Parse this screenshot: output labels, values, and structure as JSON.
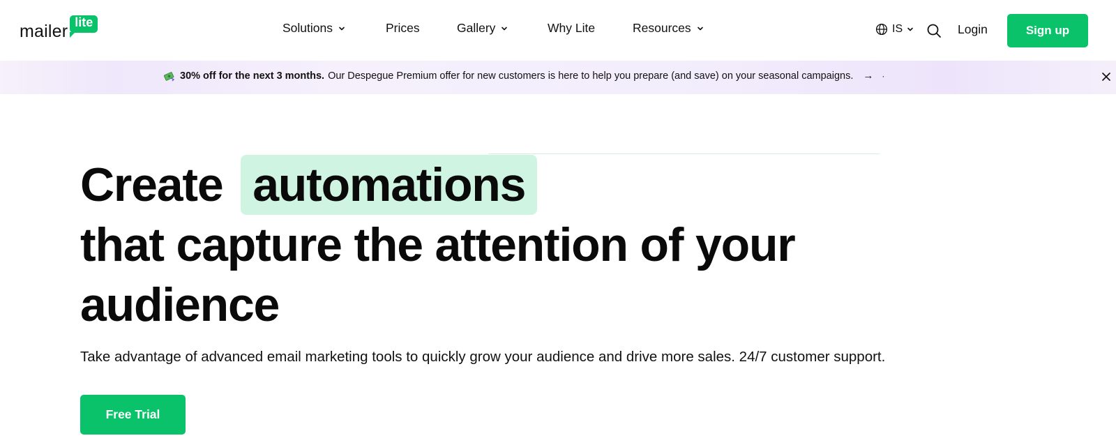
{
  "header": {
    "logo_text": "mailer",
    "logo_badge": "lite",
    "nav": {
      "solutions": "Solutions",
      "prices": "Prices",
      "gallery": "Gallery",
      "why_lite": "Why Lite",
      "resources": "Resources"
    },
    "language": "IS",
    "login": "Login",
    "signup": "Sign up"
  },
  "promo": {
    "emoji_icon": "money-icon",
    "strong_text": "30% off for the next 3 months.",
    "text": "Our Despegue Premium offer for new customers is here to help you prepare (and save) on your seasonal campaigns.",
    "arrow": "→",
    "dot": "·"
  },
  "hero": {
    "title_prefix": "Create",
    "title_highlight": "automations",
    "title_line2": "that capture the attention of your",
    "title_line3": "audience",
    "subtitle": "Take advantage of advanced email marketing tools to quickly grow your audience and drive more sales. 24/7 customer support.",
    "cta": "Free Trial"
  },
  "colors": {
    "brand_green": "#09c269",
    "highlight_bg": "#d0f4e2",
    "promo_bg": "#f3eefc"
  }
}
